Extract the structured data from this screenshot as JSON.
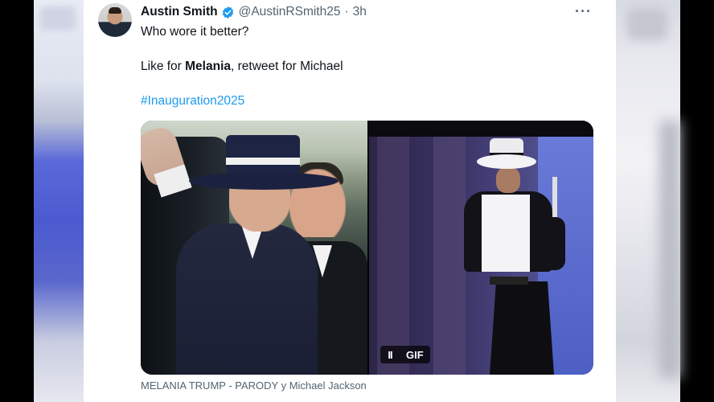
{
  "tweet": {
    "author_name": "Austin Smith",
    "handle": "@AustinRSmith25",
    "separator": "·",
    "time": "3h",
    "more_label": "···",
    "line1": "Who wore it better?",
    "line2_prefix": "Like for ",
    "line2_bold": "Melania",
    "line2_suffix": ", retweet for Michael",
    "hashtag": "#Inauguration2025"
  },
  "media": {
    "pause_icon": "II",
    "gif_label": "GIF",
    "caption": "MELANIA TRUMP - PARODY y Michael Jackson"
  },
  "colors": {
    "link": "#1d9bf0",
    "verified": "#1d9bf0",
    "secondary_text": "#536471",
    "primary_text": "#0f1419"
  },
  "icons": {
    "verified": "verified-badge-icon",
    "more": "more-horizontal-icon",
    "pause": "pause-icon"
  }
}
